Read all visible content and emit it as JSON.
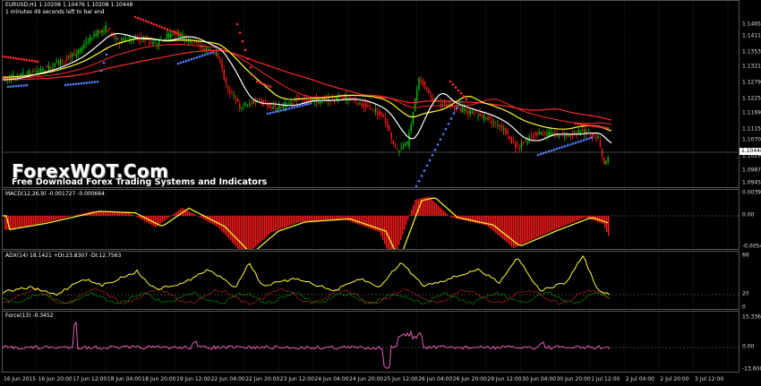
{
  "main": {
    "symbol_header": "EURUSD,H1  1.10208 1.10476 1.10208 1.10448",
    "timer_text": "1 minutes 49 seconds left to bar end",
    "price_labels": [
      "1.14650",
      "1.14110",
      "1.13530",
      "1.13210",
      "1.12790",
      "1.12250",
      "1.11690",
      "1.11150",
      "1.10700",
      "1.10290",
      "1.09870",
      "1.09450"
    ],
    "current_price": "1.10448",
    "colors": {
      "candle_up": "#00c800",
      "candle_down": "#ff1a1a",
      "ma_white": "#ffffff",
      "ma_yellow": "#ffff33",
      "ma_red": "#ff2a2a",
      "dots_blue": "#4d7dff",
      "dots_red": "#ff2a2a"
    }
  },
  "watermark": {
    "title": "ForexWOT.Com",
    "subtitle": "Free Download Forex Trading Systems and Indicators"
  },
  "macd": {
    "header": "MACD(12,26,9) -0.001727 -0.000664",
    "levels": [
      "0.00392",
      "0.00",
      "-0.00545"
    ],
    "colors": {
      "histogram": "#ff1a1a",
      "signal": "#ffff33"
    }
  },
  "adx": {
    "header": "ADX(14) 18.1421 +DI:23.8307 -DI:12.7563",
    "levels": [
      "66",
      "20",
      "0"
    ],
    "colors": {
      "adx": "#ffff33",
      "plus_di": "#00c800",
      "minus_di": "#ff3030"
    }
  },
  "force": {
    "header": "Force(13) -0.3452",
    "levels": [
      "15.3362",
      "0.00",
      "-13.6007"
    ],
    "colors": {
      "line": "#ff66cc"
    }
  },
  "time_axis": [
    "16 Jun 2015",
    "16 Jun 20:00",
    "17 Jun 12:00",
    "18 Jun 04:00",
    "18 Jun 20:00",
    "19 Jun 12:00",
    "22 Jun 04:00",
    "22 Jun 20:00",
    "23 Jun 12:00",
    "24 Jun 04:00",
    "24 Jun 20:00",
    "25 Jun 12:00",
    "26 Jun 04:00",
    "26 Jun 20:00",
    "29 Jun 12:00",
    "30 Jun 04:00",
    "30 Jun 20:00",
    "1 Jul 12:00",
    "2 Jul 04:00",
    "2 Jul 20:00",
    "3 Jul 12:00"
  ]
}
